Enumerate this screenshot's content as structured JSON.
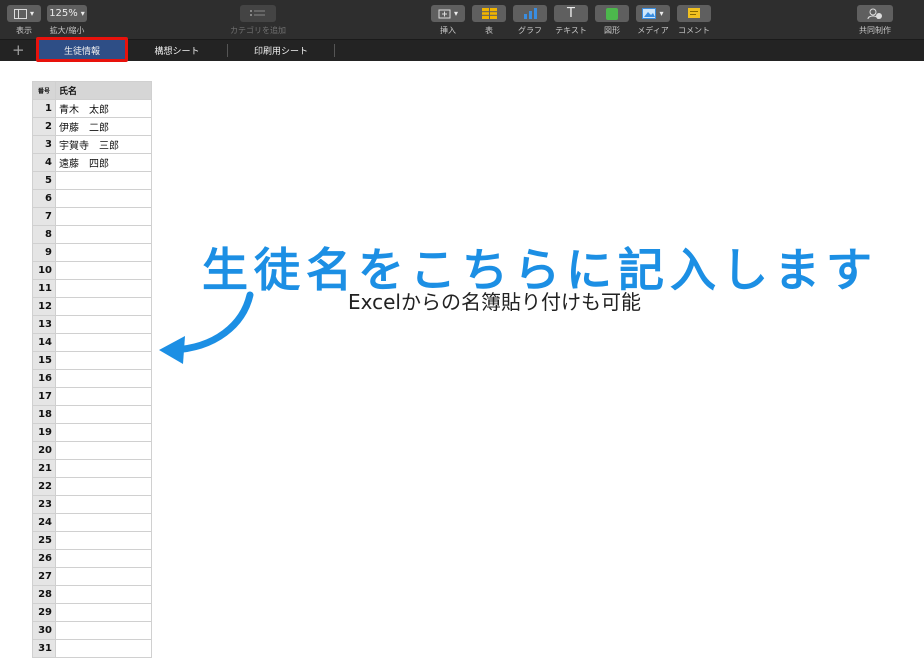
{
  "toolbar": {
    "view_label": "表示",
    "zoom_value": "125%",
    "zoom_label": "拡大/縮小",
    "category_label": "カテゴリを追加",
    "insert_label": "挿入",
    "table_label": "表",
    "chart_label": "グラフ",
    "text_label": "テキスト",
    "shape_label": "図形",
    "media_label": "メディア",
    "comment_label": "コメント",
    "collab_label": "共同制作",
    "text_icon_glyph": "T"
  },
  "tabs": {
    "add_glyph": "+",
    "items": [
      {
        "label": "生徒情報"
      },
      {
        "label": "構想シート"
      },
      {
        "label": "印刷用シート"
      }
    ]
  },
  "sheet": {
    "headers": {
      "num": "番号",
      "name": "氏名"
    },
    "rows": [
      {
        "num": "1",
        "name": "青木　太郎"
      },
      {
        "num": "2",
        "name": "伊藤　二郎"
      },
      {
        "num": "3",
        "name": "宇賀寺　三郎"
      },
      {
        "num": "4",
        "name": "遠藤　四郎"
      },
      {
        "num": "5",
        "name": ""
      },
      {
        "num": "6",
        "name": ""
      },
      {
        "num": "7",
        "name": ""
      },
      {
        "num": "8",
        "name": ""
      },
      {
        "num": "9",
        "name": ""
      },
      {
        "num": "10",
        "name": ""
      },
      {
        "num": "11",
        "name": ""
      },
      {
        "num": "12",
        "name": ""
      },
      {
        "num": "13",
        "name": ""
      },
      {
        "num": "14",
        "name": ""
      },
      {
        "num": "15",
        "name": ""
      },
      {
        "num": "16",
        "name": ""
      },
      {
        "num": "17",
        "name": ""
      },
      {
        "num": "18",
        "name": ""
      },
      {
        "num": "19",
        "name": ""
      },
      {
        "num": "20",
        "name": ""
      },
      {
        "num": "21",
        "name": ""
      },
      {
        "num": "22",
        "name": ""
      },
      {
        "num": "23",
        "name": ""
      },
      {
        "num": "24",
        "name": ""
      },
      {
        "num": "25",
        "name": ""
      },
      {
        "num": "26",
        "name": ""
      },
      {
        "num": "27",
        "name": ""
      },
      {
        "num": "28",
        "name": ""
      },
      {
        "num": "29",
        "name": ""
      },
      {
        "num": "30",
        "name": ""
      },
      {
        "num": "31",
        "name": ""
      }
    ]
  },
  "annotation": {
    "main": "生徒名をこちらに記入します",
    "sub": "Excelからの名簿貼り付けも可能"
  },
  "colors": {
    "accent_blue": "#1c8fe4",
    "highlight_red": "#e8120c",
    "active_tab": "#2e4e86"
  }
}
